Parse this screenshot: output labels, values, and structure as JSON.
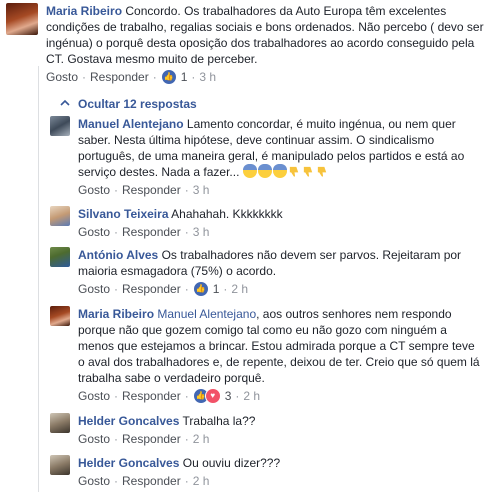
{
  "top_comment": {
    "author": "Maria Ribeiro",
    "text": "Concordo. Os trabalhadores da Auto Europa têm excelentes condições de trabalho, regalias sociais e bons ordenados. Não percebo ( devo ser ingénua) o porquê desta oposição dos trabalhadores ao acordo conseguido pela CT. Gostava mesmo muito de perceber.",
    "like_label": "Gosto",
    "reply_label": "Responder",
    "reaction_count": "1",
    "time": "3 h"
  },
  "replies_toggle": {
    "label": "Ocultar 12 respostas"
  },
  "replies": [
    {
      "author": "Manuel Alentejano",
      "text": "Lamento concordar, é muito ingénua, ou nem quer saber. Nesta última hipótese, deve continuar assim. O sindicalismo português, de uma maneira geral, é manipulado pelos partidos e está ao serviço destes. Nada a fazer...",
      "like_label": "Gosto",
      "reply_label": "Responder",
      "time": "3 h"
    },
    {
      "author": "Silvano Teixeira",
      "text": "Ahahahah. Kkkkkkkk",
      "like_label": "Gosto",
      "reply_label": "Responder",
      "time": "3 h"
    },
    {
      "author": "António Alves",
      "text": "Os trabalhadores não devem ser parvos. Rejeitaram por maioria esmagadora (75%) o acordo.",
      "like_label": "Gosto",
      "reply_label": "Responder",
      "reaction_count": "1",
      "time": "2 h"
    },
    {
      "author": "Maria Ribeiro",
      "mention": "Manuel Alentejano",
      "text": ", aos outros senhores nem respondo porque não que gozem comigo tal como eu não gozo com ninguém a menos que estejamos a brincar. Estou admirada porque a CT sempre teve o aval dos trabalhadores e, de repente, deixou de ter. Creio que só quem lá trabalha sabe o verdadeiro porquê.",
      "like_label": "Gosto",
      "reply_label": "Responder",
      "reaction_count": "3",
      "time": "2 h"
    },
    {
      "author": "Helder Goncalves",
      "text": "Trabalha la??",
      "like_label": "Gosto",
      "reply_label": "Responder",
      "time": "2 h"
    },
    {
      "author": "Helder Goncalves",
      "text": "Ou ouviu dizer???",
      "like_label": "Gosto",
      "reply_label": "Responder",
      "time": "2 h"
    }
  ]
}
